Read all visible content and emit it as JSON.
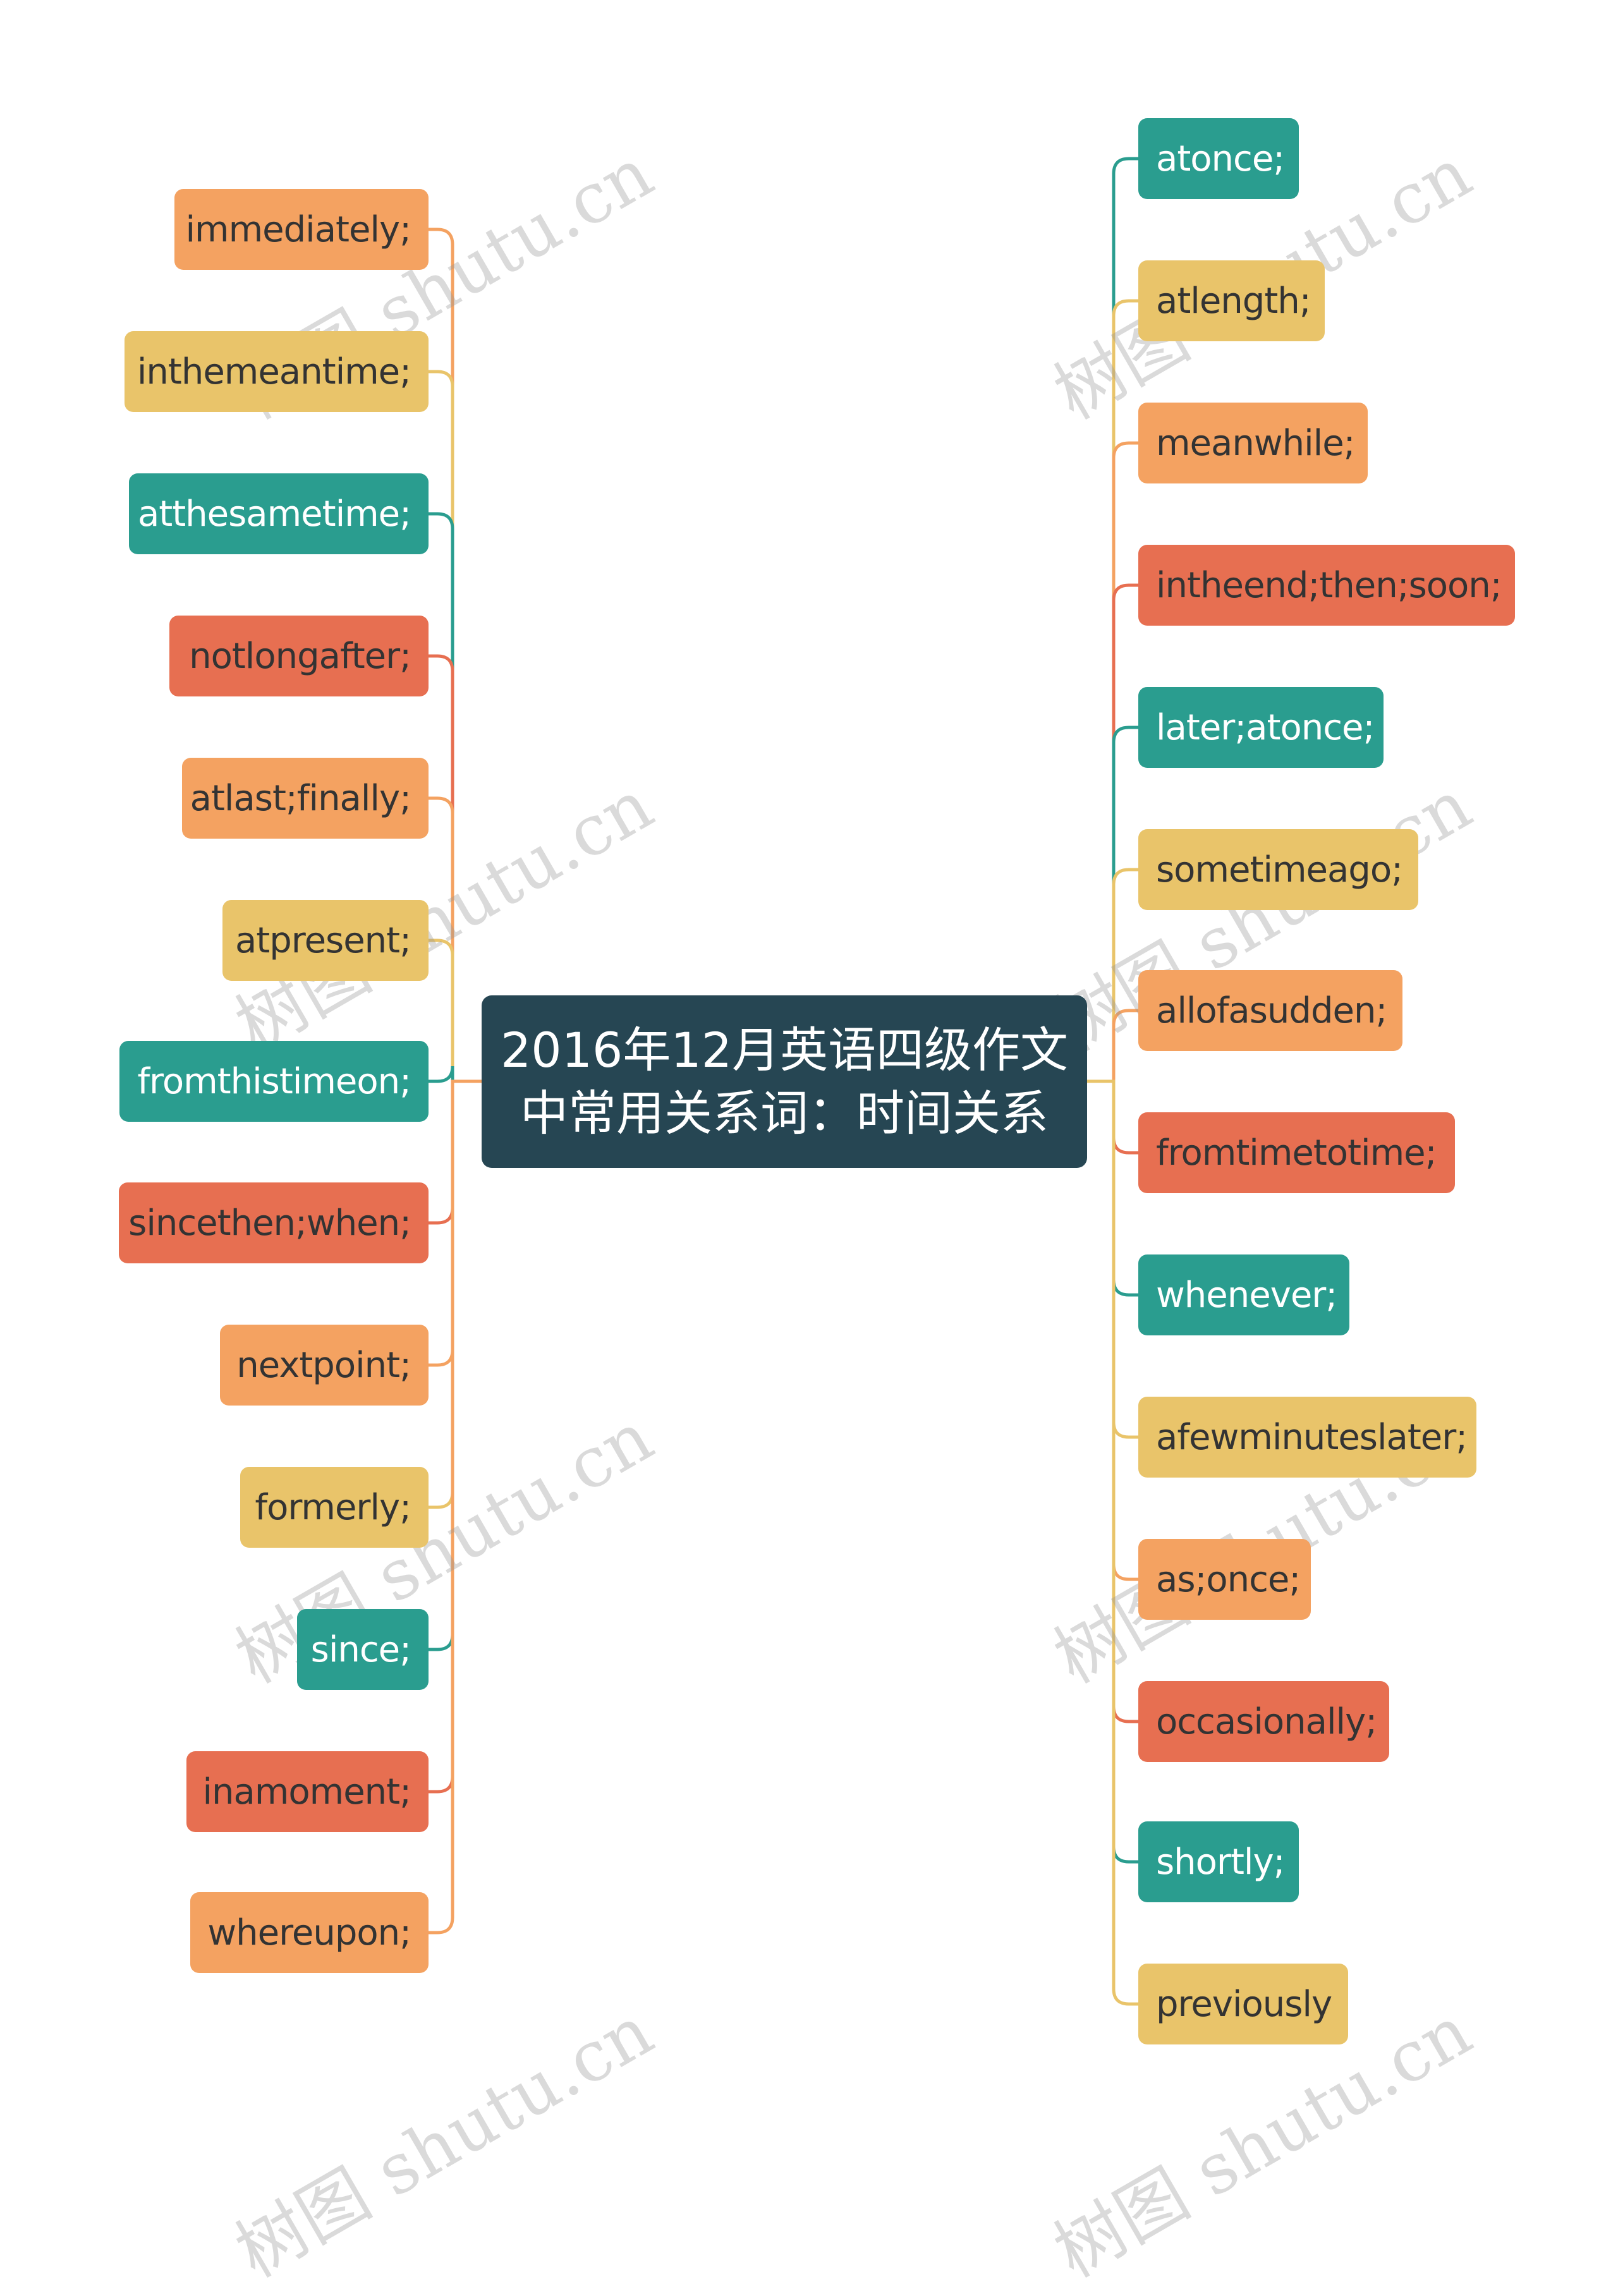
{
  "center": {
    "line1": "2016年12月英语四级作文",
    "line2": "中常用关系词：时间关系"
  },
  "colors": {
    "teal": "#2A9D8F",
    "yellow": "#E9C46A",
    "orange": "#F4A261",
    "red": "#E76F51",
    "center": "#264653"
  },
  "left_nodes": [
    {
      "label": "immediately;",
      "color": "orange"
    },
    {
      "label": "inthemeantime;",
      "color": "yellow"
    },
    {
      "label": "atthesametime;",
      "color": "teal"
    },
    {
      "label": "notlongafter;",
      "color": "red"
    },
    {
      "label": "atlast;finally;",
      "color": "orange"
    },
    {
      "label": "atpresent;",
      "color": "yellow"
    },
    {
      "label": "fromthistimeon;",
      "color": "teal"
    },
    {
      "label": "sincethen;when;",
      "color": "red"
    },
    {
      "label": "nextpoint;",
      "color": "orange"
    },
    {
      "label": "formerly;",
      "color": "yellow"
    },
    {
      "label": "since;",
      "color": "teal"
    },
    {
      "label": "inamoment;",
      "color": "red"
    },
    {
      "label": "whereupon;",
      "color": "orange"
    }
  ],
  "right_nodes": [
    {
      "label": "atonce;",
      "color": "teal"
    },
    {
      "label": "atlength;",
      "color": "yellow"
    },
    {
      "label": "meanwhile;",
      "color": "orange"
    },
    {
      "label": "intheend;then;soon;",
      "color": "red"
    },
    {
      "label": "later;atonce;",
      "color": "teal"
    },
    {
      "label": "sometimeago;",
      "color": "yellow"
    },
    {
      "label": "allofasudden;",
      "color": "orange"
    },
    {
      "label": "fromtimetotime;",
      "color": "red"
    },
    {
      "label": "whenever;",
      "color": "teal"
    },
    {
      "label": "afewminuteslater;",
      "color": "yellow"
    },
    {
      "label": "as;once;",
      "color": "orange"
    },
    {
      "label": "occasionally;",
      "color": "red"
    },
    {
      "label": "shortly;",
      "color": "teal"
    },
    {
      "label": "previously",
      "color": "yellow"
    }
  ],
  "watermark": "树图 shutu.cn"
}
